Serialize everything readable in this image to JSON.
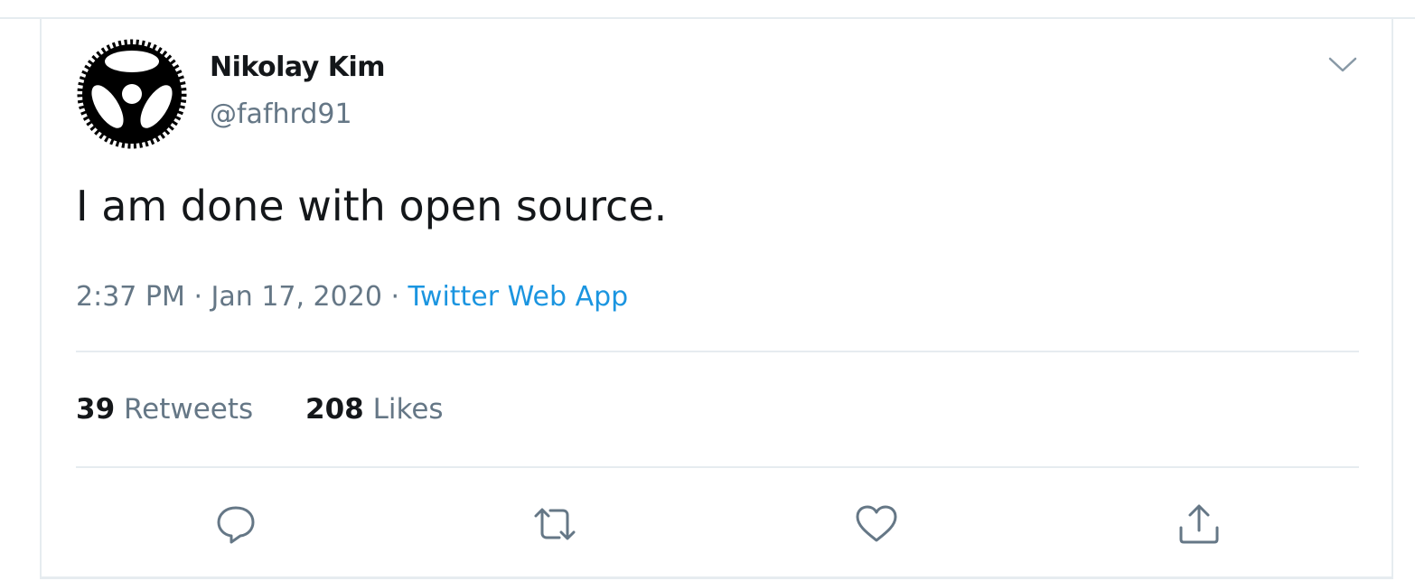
{
  "tweet": {
    "author": {
      "display_name": "Nikolay Kim",
      "handle": "@fafhrd91",
      "avatar_icon": "gear-cog-avatar-icon"
    },
    "menu_icon": "chevron-down-icon",
    "text": "I am done with open source.",
    "time": "2:37 PM",
    "separator": "·",
    "date": "Jan 17, 2020",
    "source": "Twitter Web App",
    "stats": {
      "retweets_count": "39",
      "retweets_label": "Retweets",
      "likes_count": "208",
      "likes_label": "Likes"
    },
    "actions": [
      "reply-icon",
      "retweet-icon",
      "like-icon",
      "share-icon"
    ]
  },
  "colors": {
    "primary_text": "#14171a",
    "secondary_text": "#657786",
    "link": "#1b95e0",
    "border": "#e6ecf0"
  }
}
